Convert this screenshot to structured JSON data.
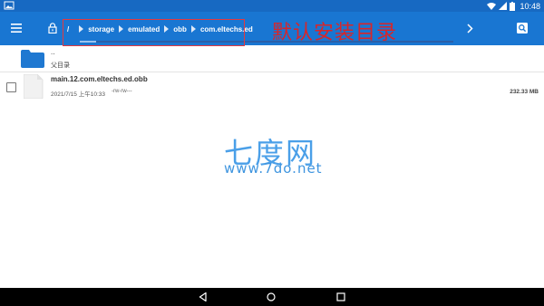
{
  "status_bar": {
    "time": "10:48"
  },
  "toolbar": {
    "breadcrumb": {
      "root": "/",
      "items": [
        "storage",
        "emulated",
        "obb",
        "com.eltechs.ed"
      ]
    }
  },
  "annotation": {
    "text": "默认安装目录"
  },
  "file_list": {
    "parent_row": {
      "name": "..",
      "subtitle": "父目录"
    },
    "files": [
      {
        "name": "main.12.com.eltechs.ed.obb",
        "date": "2021/7/15 上午10:33",
        "permissions": "-rw-rw---",
        "size": "232.33 MB"
      }
    ]
  },
  "watermark": {
    "main": "七度网",
    "sub": "www.7do.net"
  },
  "colors": {
    "toolbar": "#1976d2",
    "status_bar": "#1769c2",
    "folder": "#1f78d1",
    "annotation": "#d7262a",
    "watermark": "#4a9fe8"
  },
  "icons": {
    "menu": "hamburger-menu-icon",
    "lock": "lock-icon",
    "next": "chevron-right-icon",
    "search": "search-icon",
    "folder": "folder-icon",
    "file": "file-icon"
  }
}
